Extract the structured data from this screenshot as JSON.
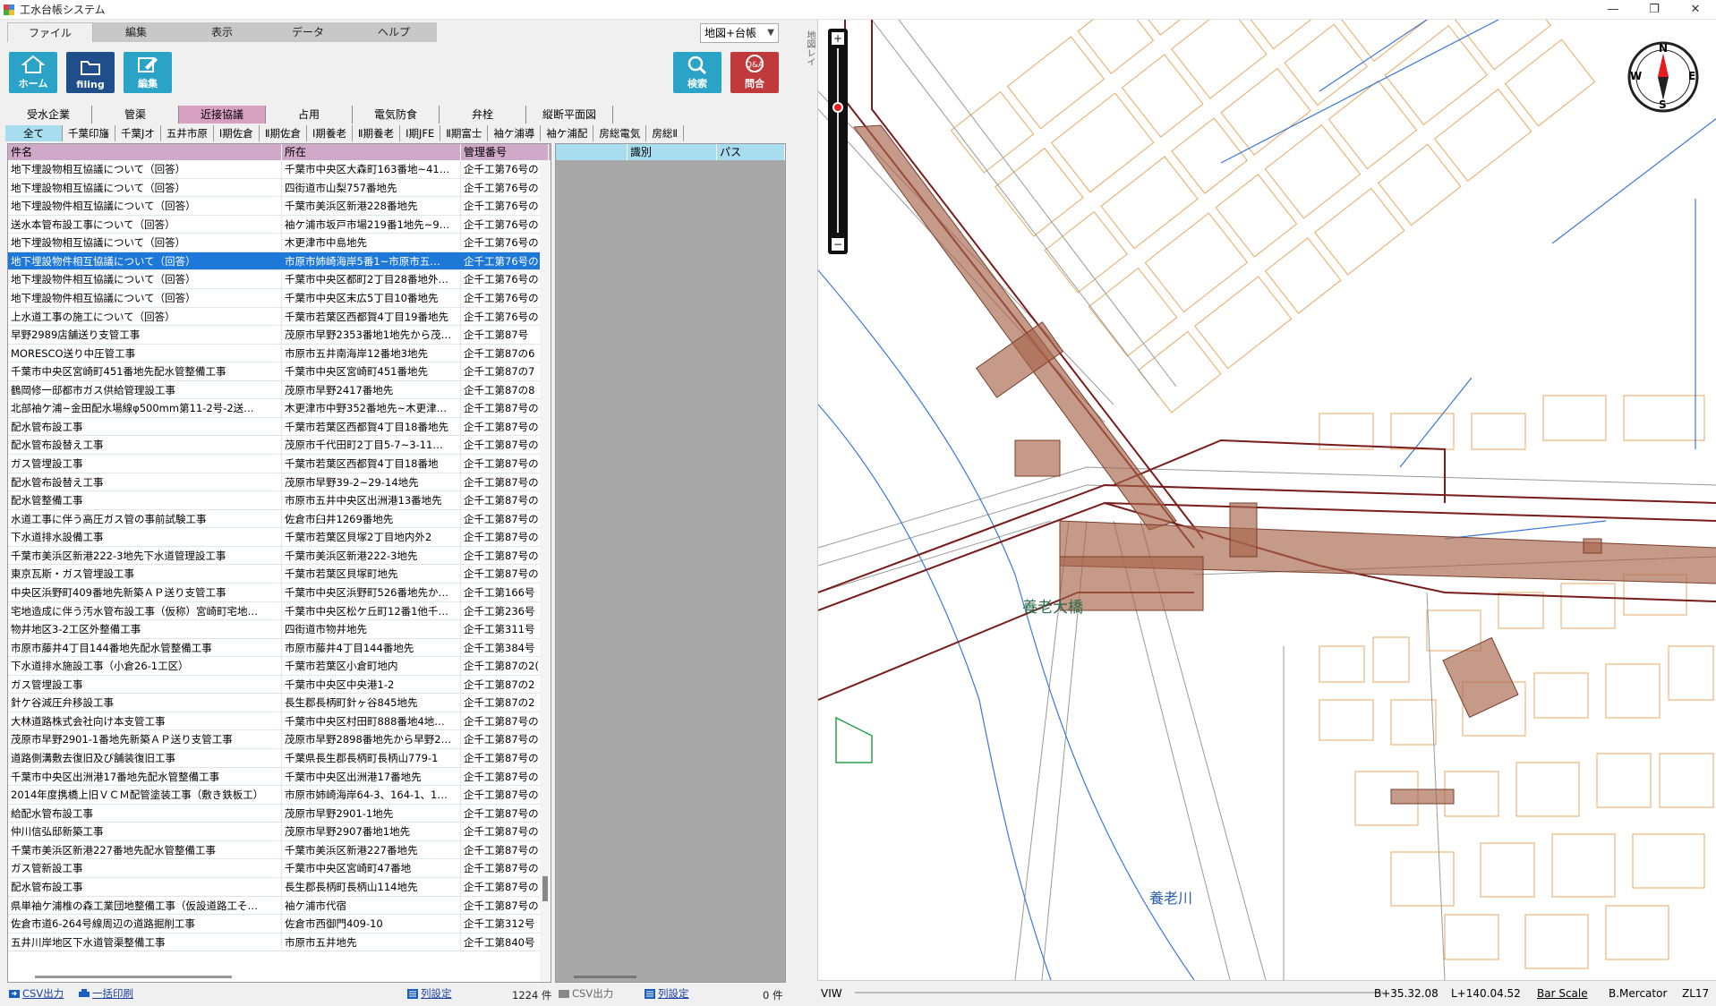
{
  "window": {
    "title": "工水台帳システム",
    "controls": [
      "—",
      "❐",
      "✕"
    ]
  },
  "menu": {
    "items": [
      "ファイル",
      "編集",
      "表示",
      "データ",
      "ヘルプ"
    ],
    "view_mode": "地図+台帳"
  },
  "toolbar": {
    "home": "ホーム",
    "filing": "filing",
    "edit": "編集",
    "search": "検索",
    "inquiry": "問合"
  },
  "category_tabs": [
    "受水企業",
    "管渠",
    "近接協議",
    "占用",
    "電気防食",
    "弁栓",
    "縦断平面図"
  ],
  "sub_tabs": [
    "全て",
    "千葉印旛",
    "千葉Jオ",
    "五井市原",
    "Ⅰ期佐倉",
    "Ⅱ期佐倉",
    "Ⅰ期養老",
    "Ⅱ期養老",
    "Ⅰ期JFE",
    "Ⅱ期富士",
    "袖ケ浦導",
    "袖ケ浦配",
    "房総電気",
    "房総Ⅱ"
  ],
  "table": {
    "columns": [
      "件名",
      "所在",
      "管理番号"
    ],
    "rows": [
      [
        "地下埋設物相互協議について（回答）",
        "千葉市中央区大森町163番地~41…",
        "企千工第76号の"
      ],
      [
        "地下埋設物相互協議について（回答）",
        "四街道市山梨757番地先",
        "企千工第76号の"
      ],
      [
        "地下埋設物件相互協議について（回答）",
        "千葉市美浜区新港228番地先",
        "企千工第76号の"
      ],
      [
        "送水本管布設工事について（回答）",
        "袖ケ浦市坂戸市場219番1地先~9…",
        "企千工第76号の"
      ],
      [
        "地下埋設物相互協議について（回答）",
        "木更津市中島地先",
        "企千工第76号の"
      ],
      [
        "地下埋設物件相互協議について（回答）",
        "市原市姉崎海岸5番1~市原市五…",
        "企千工第76号の"
      ],
      [
        "地下埋設物件相互協議について（回答）",
        "千葉市中央区都町2丁目28番地外…",
        "企千工第76号の"
      ],
      [
        "地下埋設物件相互協議について（回答）",
        "千葉市中央区末広5丁目10番地先",
        "企千工第76号の"
      ],
      [
        "上水道工事の施工について（回答）",
        "千葉市若葉区西都賀4丁目19番地先",
        "企千工第76号の"
      ],
      [
        "早野2989店舗送り支管工事",
        "茂原市早野2353番地1地先から茂…",
        "企千工第87号"
      ],
      [
        "MORESCO送り中圧管工事",
        "市原市五井南海岸12番地3地先",
        "企千工第87の6"
      ],
      [
        "千葉市中央区宮崎町451番地先配水管整備工事",
        "千葉市中央区宮崎町451番地先",
        "企千工第87の7"
      ],
      [
        "鶴岡修一邸都市ガス供給管理設工事",
        "茂原市早野2417番地先",
        "企千工第87の8"
      ],
      [
        "北部袖ケ浦~金田配水場線φ500mm第11-2号-2送…",
        "木更津市中野352番地先~木更津…",
        "企千工第87号の"
      ],
      [
        "配水管布設工事",
        "千葉市若葉区西都賀4丁目18番地先",
        "企千工第87号の"
      ],
      [
        "配水管布設替え工事",
        "茂原市千代田町2丁目5-7~3-11…",
        "企千工第87号の"
      ],
      [
        "ガス管埋設工事",
        "千葉市若葉区西都賀4丁目18番地",
        "企千工第87号の"
      ],
      [
        "配水管布設替え工事",
        "茂原市早野39-2~29-14地先",
        "企千工第87号の"
      ],
      [
        "配水管整備工事",
        "市原市五井中央区出洲港13番地先",
        "企千工第87号の"
      ],
      [
        "水道工事に伴う高圧ガス管の事前試験工事",
        "佐倉市臼井1269番地先",
        "企千工第87号の"
      ],
      [
        "下水道排水設備工事",
        "千葉市若葉区貝塚2丁目地内外2",
        "企千工第87号の"
      ],
      [
        "千葉市美浜区新港222-3地先下水道管理設工事",
        "千葉市美浜区新港222-3地先",
        "企千工第87号の"
      ],
      [
        "東京瓦斯・ガス管埋設工事",
        "千葉市若葉区貝塚町地先",
        "企千工第87号の"
      ],
      [
        "中央区浜野町409番地先新築ＡＰ送り支管工事",
        "千葉市中央区浜野町526番地先か…",
        "企千工第166号"
      ],
      [
        "宅地造成に伴う汚水管布設工事（仮称）宮崎町宅地…",
        "千葉市中央区松ケ丘町12番1他千…",
        "企千工第236号"
      ],
      [
        "物井地区3-2工区外整備工事",
        "四街道市物井地先",
        "企千工第311号"
      ],
      [
        "市原市藤井4丁目144番地先配水管整備工事",
        "市原市藤井4丁目144番地先",
        "企千工第384号"
      ],
      [
        "下水道排水施設工事（小倉26-1工区）",
        "千葉市若葉区小倉町地内",
        "企千工第87の2("
      ],
      [
        "ガス管埋設工事",
        "千葉市中央区中央港1-2",
        "企千工第87の2"
      ],
      [
        "針ケ谷減圧弁移設工事",
        "長生郡長柄町針ヶ谷845地先",
        "企千工第87の2"
      ],
      [
        "大林道路株式会社向け本支管工事",
        "千葉市中央区村田町888番地4地…",
        "企千工第87号の"
      ],
      [
        "茂原市早野2901-1番地先新築ＡＰ送り支管工事",
        "茂原市早野2898番地先から早野2…",
        "企千工第87号の"
      ],
      [
        "道路側溝敷去復旧及び舗装復旧工事",
        "千葉県長生郡長柄町長柄山779-1",
        "企千工第87号の"
      ],
      [
        "千葉市中央区出洲港17番地先配水管整備工事",
        "千葉市中央区出洲港17番地先",
        "企千工第87号の"
      ],
      [
        "2014年度携橋上旧ＶＣＭ配管塗装工事（敷き鉄板工）",
        "市原市姉崎海岸64-3、164-1、1…",
        "企千工第87号の"
      ],
      [
        "給配水管布設工事",
        "茂原市早野2901-1地先",
        "企千工第87号の"
      ],
      [
        "仲川信弘邸新築工事",
        "茂原市早野2907番地1地先",
        "企千工第87号の"
      ],
      [
        "千葉市美浜区新港227番地先配水管整備工事",
        "千葉市美浜区新港227番地先",
        "企千工第87号の"
      ],
      [
        "ガス管新設工事",
        "千葉市中央区宮崎町47番地",
        "企千工第87号の"
      ],
      [
        "配水管布設工事",
        "長生郡長柄町長柄山114地先",
        "企千工第87号の"
      ],
      [
        "県単袖ケ浦椎の森工業団地整備工事（仮設道路工そ…",
        "袖ケ浦市代宿",
        "企千工第87号の"
      ],
      [
        "佐倉市道6-264号線周辺の道路掘削工事",
        "佐倉市西御門409-10",
        "企千工第312号"
      ],
      [
        "五井川岸地区下水道管渠整備工事",
        "市原市五井地先",
        "企千工第840号"
      ]
    ],
    "selected_index": 5
  },
  "right_table": {
    "columns": [
      "識別",
      "パス"
    ]
  },
  "bottom_bar": {
    "csv_label": "CSV出力",
    "print_label": "一括印刷",
    "column_settings_label": "列設定",
    "record_count": "1224 件",
    "right_csv_label": "CSV出力",
    "right_column_settings_label": "列設定",
    "right_count": "0 件"
  },
  "map": {
    "side_label": "地図レイ",
    "labels": {
      "bridge": "養老大橋",
      "river": "養老川"
    },
    "compass": {
      "n": "N",
      "s": "S",
      "e": "E",
      "w": "W"
    },
    "colors": {
      "parcel": "#e8a860",
      "road_dark": "#7a1c1c",
      "pipe_fill": "#a8644a",
      "water": "#3a78d8"
    }
  },
  "status": {
    "view_label": "VIW",
    "latitude": "B+35.32.08",
    "longitude": "L+140.04.52",
    "scale": "Bar Scale",
    "projection": "B.Mercator",
    "zoom_level": "ZL17"
  }
}
